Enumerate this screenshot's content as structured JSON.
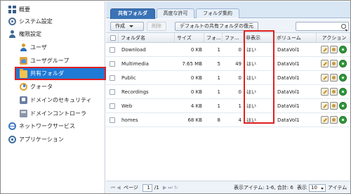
{
  "sidebar": {
    "items": [
      {
        "label": "概要",
        "icon": "dashboard-icon"
      },
      {
        "label": "システム設定",
        "icon": "gear-icon"
      },
      {
        "label": "権限設定",
        "icon": "user-icon"
      },
      {
        "label": "ユーザ",
        "icon": "user-icon"
      },
      {
        "label": "ユーザグループ",
        "icon": "user-group-icon"
      },
      {
        "label": "共有フォルダ",
        "icon": "folder-icon"
      },
      {
        "label": "クォータ",
        "icon": "quota-icon"
      },
      {
        "label": "ドメインのセキュリティ",
        "icon": "domain-security-icon"
      },
      {
        "label": "ドメインコントローラ",
        "icon": "domain-controller-icon"
      },
      {
        "label": "ネットワークサービス",
        "icon": "network-icon"
      },
      {
        "label": "アプリケーション",
        "icon": "application-icon"
      }
    ],
    "active_index": 5,
    "highlight_color": "#e02020",
    "active_bg": "#1f7ad6"
  },
  "tabs": [
    {
      "label": "共有フォルダ",
      "active": true
    },
    {
      "label": "高度な許可",
      "active": false
    },
    {
      "label": "フォルダ集約",
      "active": false
    }
  ],
  "toolbar": {
    "create_label": "作成",
    "delete_label": "削除",
    "restore_label": "デフォルトの共有フォルダの復元",
    "search_placeholder": ""
  },
  "table": {
    "columns": [
      "フォルダ名",
      "サイズ",
      "フォ...",
      "ファ...",
      "非表示",
      "ボリューム",
      "アクション"
    ],
    "rows": [
      {
        "name": "Download",
        "size": "0 KB",
        "folders": "1",
        "files": "0",
        "hidden": "はい",
        "volume": "DataVol1"
      },
      {
        "name": "Multimedia",
        "size": "7.65 MB",
        "folders": "5",
        "files": "49",
        "hidden": "はい",
        "volume": "DataVol1"
      },
      {
        "name": "Public",
        "size": "0 KB",
        "folders": "1",
        "files": "0",
        "hidden": "はい",
        "volume": "DataVol1"
      },
      {
        "name": "Recordings",
        "size": "0 KB",
        "folders": "1",
        "files": "0",
        "hidden": "はい",
        "volume": "DataVol1"
      },
      {
        "name": "Web",
        "size": "4 KB",
        "folders": "1",
        "files": "1",
        "hidden": "はい",
        "volume": "DataVol1"
      },
      {
        "name": "homes",
        "size": "68 KB",
        "folders": "8",
        "files": "4",
        "hidden": "はい",
        "volume": "DataVol1"
      }
    ]
  },
  "pager": {
    "page_label": "ページ",
    "page_value": "1",
    "page_total": "/1",
    "display_info": "表示アイテム: 1-6, 合計: 6",
    "display_label": "表示",
    "per_page": "10",
    "items_label": "アイテム"
  }
}
